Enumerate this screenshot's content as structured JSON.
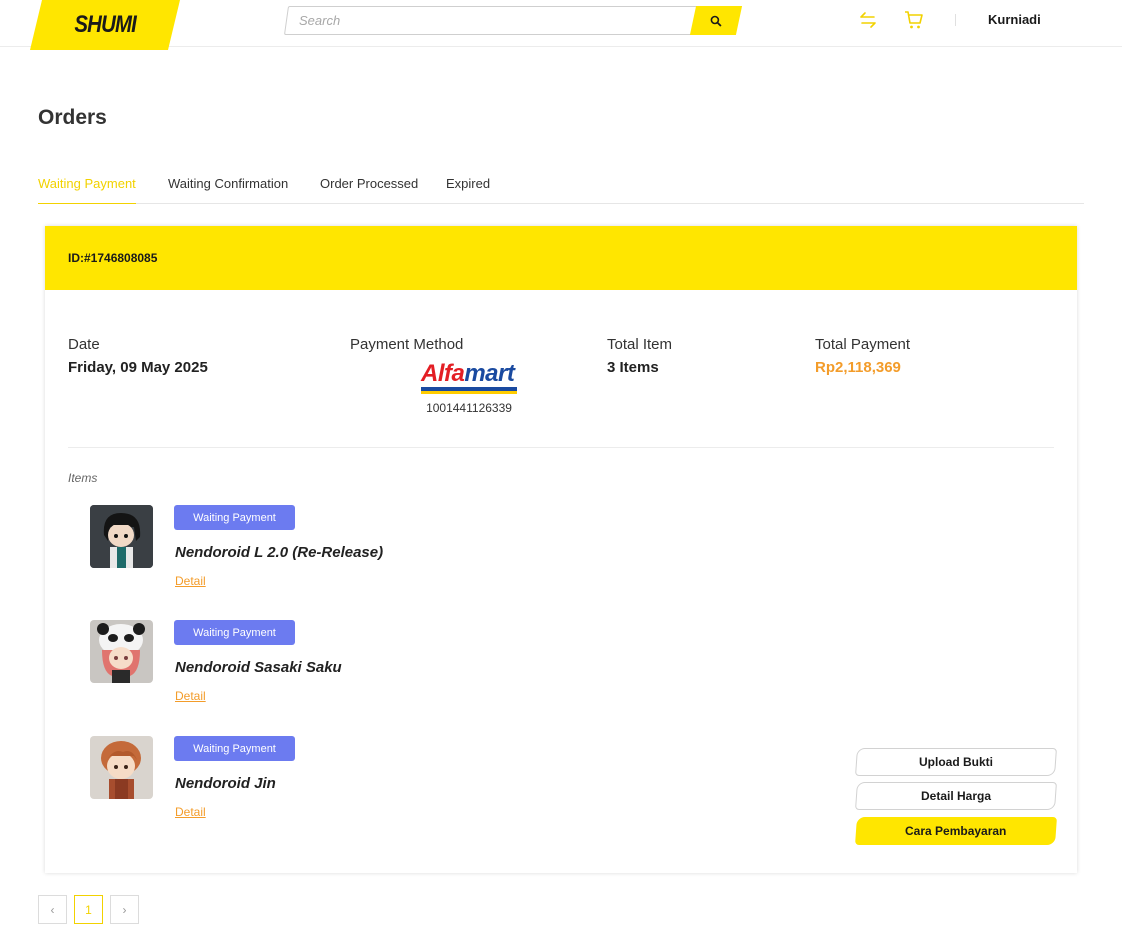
{
  "header": {
    "logo_text": "SHUMI",
    "search_placeholder": "Search",
    "username": "Kurniadi",
    "icons": [
      "logo",
      "search-icon",
      "swap-icon",
      "cart-icon"
    ],
    "accent_color": "#ffe600"
  },
  "page": {
    "title": "Orders"
  },
  "tabs": [
    {
      "label": "Waiting Payment",
      "active": true
    },
    {
      "label": "Waiting Confirmation",
      "active": false
    },
    {
      "label": "Order Processed",
      "active": false
    },
    {
      "label": "Expired",
      "active": false
    }
  ],
  "order": {
    "id": "ID:#1746808085",
    "date_label": "Date",
    "date_value": "Friday, 09 May 2025",
    "payment_label": "Payment Method",
    "payment_brand": "Alfamart",
    "payment_code": "1001441126339",
    "total_item_label": "Total Item",
    "total_item_value": "3 Items",
    "total_payment_label": "Total Payment",
    "total_payment_value": "Rp2,118,369",
    "items_label": "Items",
    "items": [
      {
        "status": "Waiting Payment",
        "name": "Nendoroid L 2.0 (Re-Release)",
        "link": "Detail"
      },
      {
        "status": "Waiting Payment",
        "name": "Nendoroid Sasaki Saku",
        "link": "Detail"
      },
      {
        "status": "Waiting Payment",
        "name": "Nendoroid Jin",
        "link": "Detail"
      }
    ],
    "actions": {
      "upload": "Upload Bukti",
      "price_detail": "Detail Harga",
      "how_to_pay": "Cara Pembayaran"
    }
  },
  "pagination": {
    "prev": "‹",
    "current": "1",
    "next": "›"
  },
  "colors": {
    "badge": "#6c7bf0",
    "price": "#f39c2a",
    "link": "#f39c2a"
  }
}
